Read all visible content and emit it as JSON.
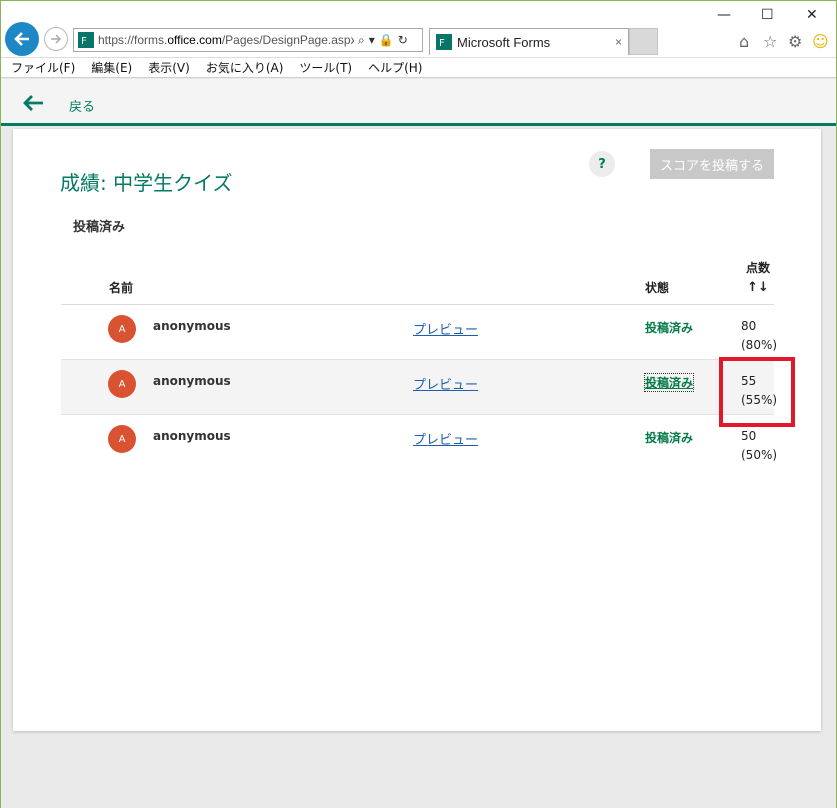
{
  "browser": {
    "url_host": "https://forms.",
    "url_domain": "office.com",
    "url_path": "/Pages/DesignPage.aspx",
    "tab_title": "Microsoft Forms",
    "tab_close": "×",
    "win_minimize": "—",
    "win_maximize": "☐",
    "win_close": "✕"
  },
  "menu": [
    "ファイル(F)",
    "編集(E)",
    "表示(V)",
    "お気に入り(A)",
    "ツール(T)",
    "ヘルプ(H)"
  ],
  "page": {
    "back_label": "戻る",
    "help_label": "?",
    "post_scores_button": "スコアを投稿する",
    "title": "成績: 中学生クイズ",
    "subtitle": "投稿済み",
    "columns": {
      "name": "名前",
      "status": "状態",
      "score": "点数",
      "sort": "↑↓"
    },
    "rows": [
      {
        "avatar": "A",
        "name": "anonymous",
        "preview": "プレビュー",
        "status": "投稿済み",
        "score": "80",
        "percent": "(80%)"
      },
      {
        "avatar": "A",
        "name": "anonymous",
        "preview": "プレビュー",
        "status": "投稿済み",
        "score": "55",
        "percent": "(55%)"
      },
      {
        "avatar": "A",
        "name": "anonymous",
        "preview": "プレビュー",
        "status": "投稿済み",
        "score": "50",
        "percent": "(50%)"
      }
    ]
  },
  "colors": {
    "accent": "#037a63",
    "avatar": "#d95332",
    "highlight_box": "#e0192a"
  }
}
